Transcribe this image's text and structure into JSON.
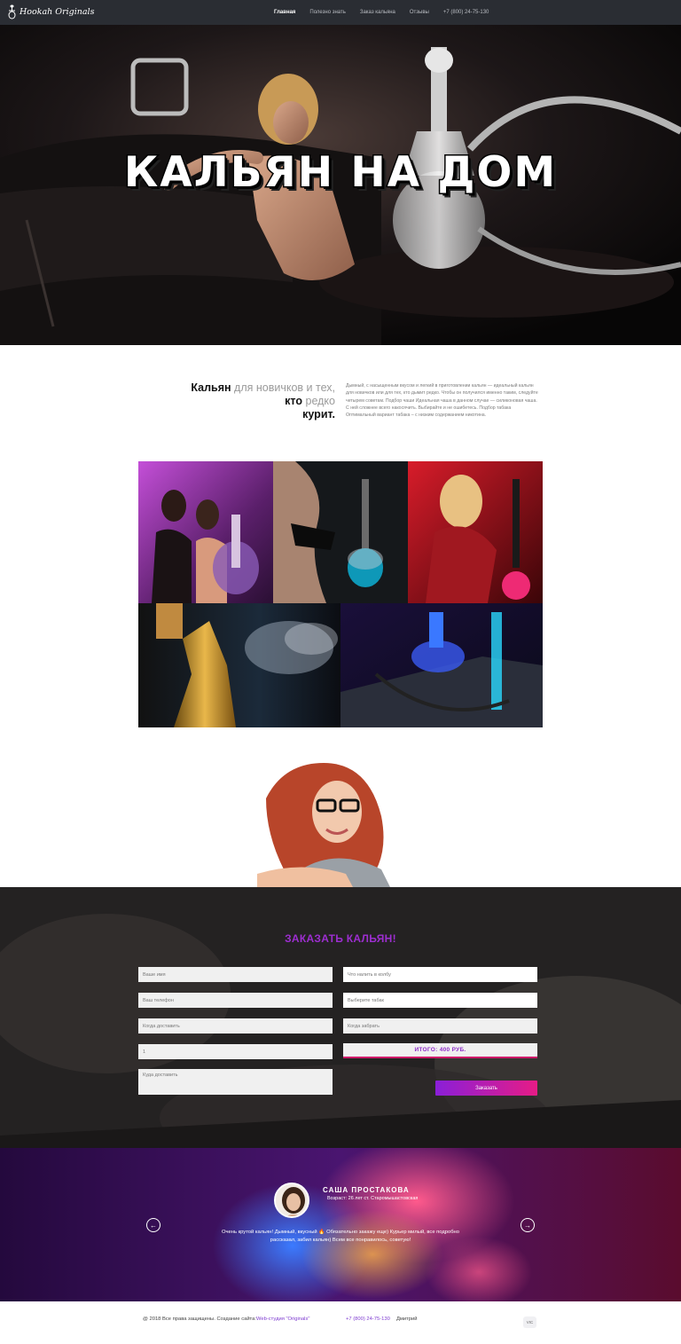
{
  "nav": {
    "logo": "Hookah Originals",
    "links": [
      "Главная",
      "Полезно знать",
      "Заказ кальяна",
      "Отзывы",
      "+7 (800) 24-75-130"
    ]
  },
  "hero": {
    "title": "КАЛЬЯН НА ДОМ"
  },
  "intro": {
    "heading_b1": "Кальян",
    "heading_l1": " для новичков и тех,",
    "heading_b2": " кто",
    "heading_l2": " редко",
    "heading_b3": "курит.",
    "text": "Дымный, с насыщенным вкусом и легкий в приготовлении кальян — идеальный кальян для новичков или для тех, кто дымит редко. Чтобы он получился именно таким, следуйте четырем советам. Подбор чаши Идеальная чаша в данном случае — силиконовая чаша. С ней сложнее всего накосячить. Выбирайте и не ошибетесь. Подбор табака Оптимальный вариант табака – с низким содержанием никотина."
  },
  "order": {
    "title": "ЗАКАЗАТЬ КАЛЬЯН!",
    "left_fields": [
      "Ваше имя",
      "Ваш телефон",
      "Когда доставить",
      "1"
    ],
    "address_placeholder": "Куда доставить",
    "right_fields": [
      "Что налить в колбу",
      "Выберите табак",
      "Когда забрать"
    ],
    "total": "ИТОГО: 400 РУБ.",
    "submit": "Заказать"
  },
  "testimonial": {
    "name": "САША ПРОСТАКОВА",
    "age": "Возраст: 26 лет ст. Старомышастовская",
    "text": "Очень крутой кальян! Дымный, вкусный 🔥 Обязательно закажу еще) Курьер милый, все подробно рассказал, забил кальян) Всем все понравилось, советую!",
    "prev": "←",
    "next": "→"
  },
  "footer": {
    "copy": "@ 2018 Все права защищены. Создание сайта:",
    "studio": "Web-студия \"Originals\"",
    "phone": "+7 (800) 24-75-130",
    "author": "Дмитрий",
    "badge": "VIC"
  },
  "colors": {
    "accent_purple": "#9d2ed0",
    "accent_pink": "#e61c86",
    "nav_bg": "#2a2d33"
  }
}
